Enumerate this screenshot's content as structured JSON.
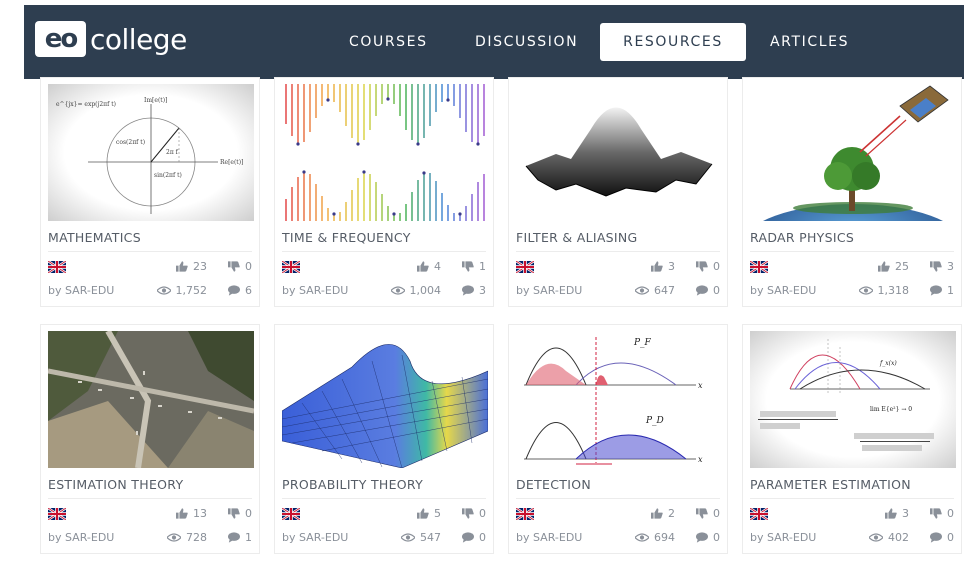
{
  "brand": {
    "logo_mark": "eo",
    "logo_text": "college"
  },
  "nav": {
    "items": [
      {
        "label": "COURSES"
      },
      {
        "label": "DISCUSSION"
      },
      {
        "label": "RESOURCES"
      },
      {
        "label": "ARTICLES"
      }
    ],
    "active": "RESOURCES"
  },
  "colors": {
    "navbar": "#2e3e50",
    "text_muted": "#8a9099",
    "title": "#555c66"
  },
  "cards": [
    {
      "title": "MATHEMATICS",
      "likes": "23",
      "dislikes": "0",
      "author": "by SAR-EDU",
      "views": "1,752",
      "comments": "6",
      "language_icon": "uk-flag-icon"
    },
    {
      "title": "TIME & FREQUENCY",
      "likes": "4",
      "dislikes": "1",
      "author": "by SAR-EDU",
      "views": "1,004",
      "comments": "3",
      "language_icon": "uk-flag-icon"
    },
    {
      "title": "FILTER & ALIASING",
      "likes": "3",
      "dislikes": "0",
      "author": "by SAR-EDU",
      "views": "647",
      "comments": "0",
      "language_icon": "uk-flag-icon"
    },
    {
      "title": "RADAR PHYSICS",
      "likes": "25",
      "dislikes": "3",
      "author": "by SAR-EDU",
      "views": "1,318",
      "comments": "1",
      "language_icon": "uk-flag-icon"
    },
    {
      "title": "ESTIMATION THEORY",
      "likes": "13",
      "dislikes": "0",
      "author": "by SAR-EDU",
      "views": "728",
      "comments": "1",
      "language_icon": "uk-flag-icon"
    },
    {
      "title": "PROBABILITY THEORY",
      "likes": "5",
      "dislikes": "0",
      "author": "by SAR-EDU",
      "views": "547",
      "comments": "0",
      "language_icon": "uk-flag-icon"
    },
    {
      "title": "DETECTION",
      "likes": "2",
      "dislikes": "0",
      "author": "by SAR-EDU",
      "views": "694",
      "comments": "0",
      "language_icon": "uk-flag-icon"
    },
    {
      "title": "PARAMETER ESTIMATION",
      "likes": "3",
      "dislikes": "0",
      "author": "by SAR-EDU",
      "views": "402",
      "comments": "0",
      "language_icon": "uk-flag-icon"
    }
  ],
  "image_text": {
    "math": {
      "eq": "e^{jx}= exp(j2πf t)",
      "im": "Im[e(t)]",
      "re": "Re[e(t)]",
      "cos": "cos(2πf t)",
      "sin": "sin(2πf t)",
      "angle": "2π f"
    },
    "detection": {
      "pf": "P_F",
      "pd": "P_D",
      "x": "x"
    },
    "param": {
      "lim": "lim E{e²} → 0",
      "fx": "f_x(x)"
    }
  }
}
